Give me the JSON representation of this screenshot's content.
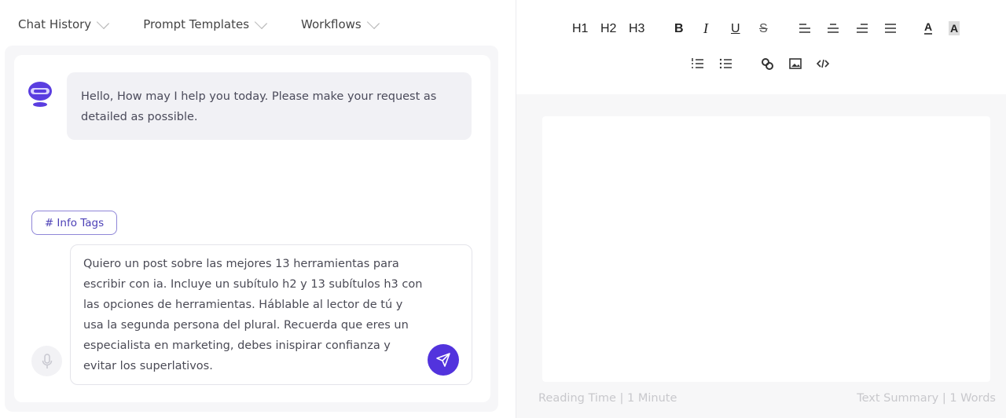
{
  "nav": [
    {
      "label": "Chat History"
    },
    {
      "label": "Prompt Templates"
    },
    {
      "label": "Workflows"
    }
  ],
  "chat": {
    "bot_message": "Hello, How may I help you today. Please make your request as detailed as possible.",
    "info_tags_label": "# Info Tags",
    "input_value": "Quiero un post sobre las mejores 13 herramientas para\nescribir con ia. Incluye un subítulo h2 y 13 subítulos h3 con\nlas opciones de herramientas. Háblable al lector de tú y\nusa la segunda persona del plural. Recuerda que eres un\nespecialista en marketing, debes inispirar confianza y\nevitar los superlativos."
  },
  "toolbar": {
    "h1": "H1",
    "h2": "H2",
    "h3": "H3",
    "bold": "B",
    "italic": "I",
    "underline": "U",
    "strike": "S",
    "font_color": "A",
    "bg_color": "A"
  },
  "footer": {
    "reading_time": "Reading Time |  1 Minute",
    "summary": "Text Summary |  1 Words"
  },
  "colors": {
    "accent": "#5233dd"
  }
}
